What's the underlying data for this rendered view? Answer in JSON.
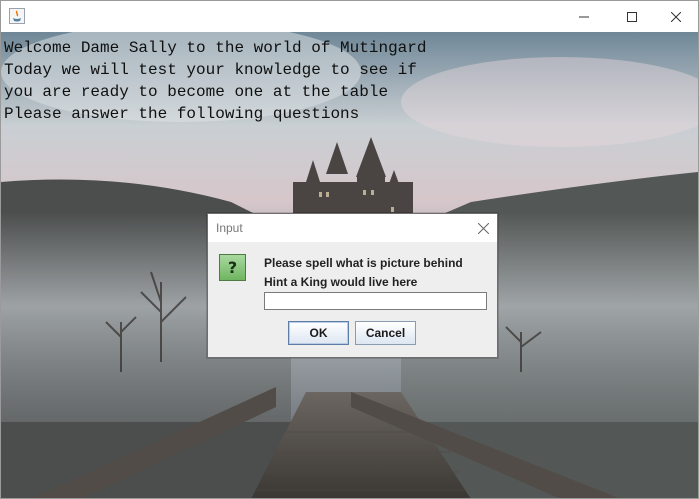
{
  "window": {
    "title": ""
  },
  "intro": {
    "lines": [
      "Welcome Dame Sally to the world of Mutingard",
      "Today we will test your knowledge to see if",
      "you are ready to become one at the table",
      "Please answer the following questions"
    ]
  },
  "dialog": {
    "title": "Input",
    "icon": "question-icon",
    "message_1": "Please spell what is picture behind",
    "message_2": "Hint a King would live here",
    "input_value": "",
    "ok_label": "OK",
    "cancel_label": "Cancel"
  },
  "colors": {
    "dialog_bg": "#eeeeee",
    "question_icon": "#7fbf6f",
    "ok_border": "#5f7ea6"
  }
}
